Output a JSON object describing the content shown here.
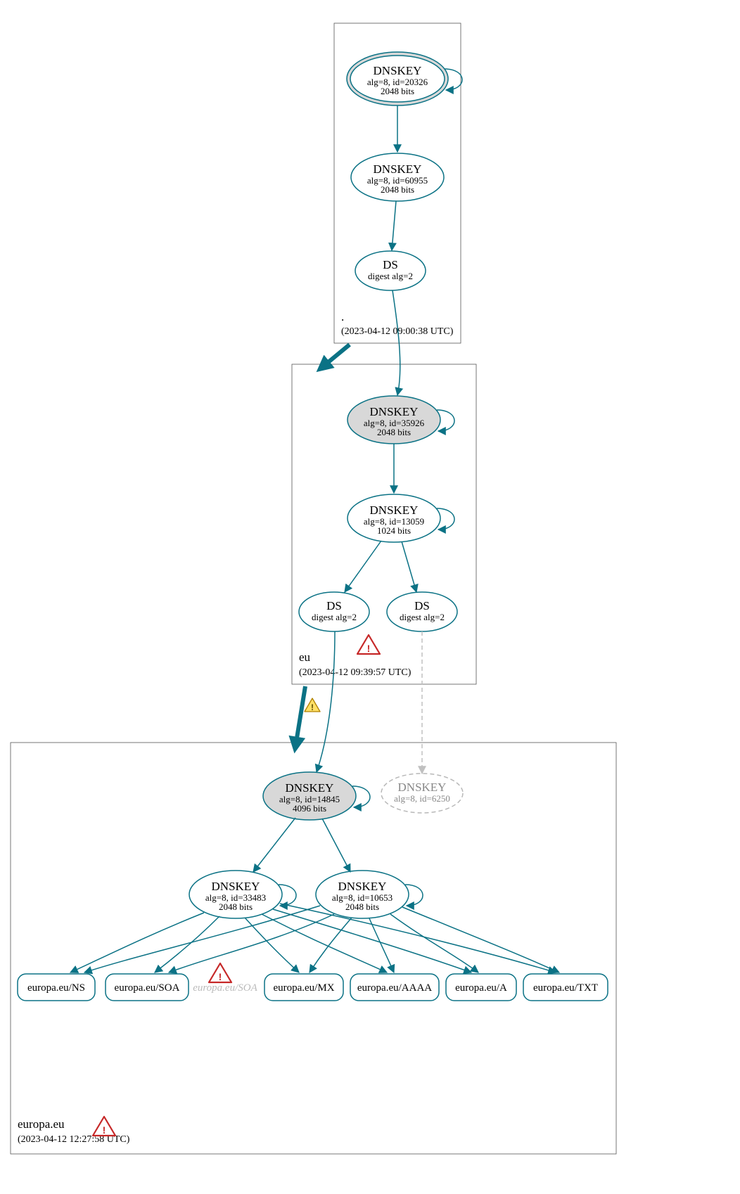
{
  "zones": {
    "root": {
      "label": ".",
      "timestamp": "(2023-04-12 09:00:38 UTC)"
    },
    "eu": {
      "label": "eu",
      "timestamp": "(2023-04-12 09:39:57 UTC)"
    },
    "europa": {
      "label": "europa.eu",
      "timestamp": "(2023-04-12 12:27:58 UTC)"
    }
  },
  "nodes": {
    "root_ksk": {
      "title": "DNSKEY",
      "line2": "alg=8, id=20326",
      "line3": "2048 bits"
    },
    "root_zsk": {
      "title": "DNSKEY",
      "line2": "alg=8, id=60955",
      "line3": "2048 bits"
    },
    "root_ds": {
      "title": "DS",
      "line2": "digest alg=2"
    },
    "eu_ksk": {
      "title": "DNSKEY",
      "line2": "alg=8, id=35926",
      "line3": "2048 bits"
    },
    "eu_zsk": {
      "title": "DNSKEY",
      "line2": "alg=8, id=13059",
      "line3": "1024 bits"
    },
    "eu_ds1": {
      "title": "DS",
      "line2": "digest alg=2"
    },
    "eu_ds2": {
      "title": "DS",
      "line2": "digest alg=2"
    },
    "eur_ksk": {
      "title": "DNSKEY",
      "line2": "alg=8, id=14845",
      "line3": "4096 bits"
    },
    "eur_dash": {
      "title": "DNSKEY",
      "line2": "alg=8, id=6250"
    },
    "eur_zsk1": {
      "title": "DNSKEY",
      "line2": "alg=8, id=33483",
      "line3": "2048 bits"
    },
    "eur_zsk2": {
      "title": "DNSKEY",
      "line2": "alg=8, id=10653",
      "line3": "2048 bits"
    },
    "rr_ns": {
      "title": "europa.eu/NS"
    },
    "rr_soa": {
      "title": "europa.eu/SOA"
    },
    "rr_soa_g": {
      "title": "europa.eu/SOA"
    },
    "rr_mx": {
      "title": "europa.eu/MX"
    },
    "rr_aaaa": {
      "title": "europa.eu/AAAA"
    },
    "rr_a": {
      "title": "europa.eu/A"
    },
    "rr_txt": {
      "title": "europa.eu/TXT"
    }
  }
}
